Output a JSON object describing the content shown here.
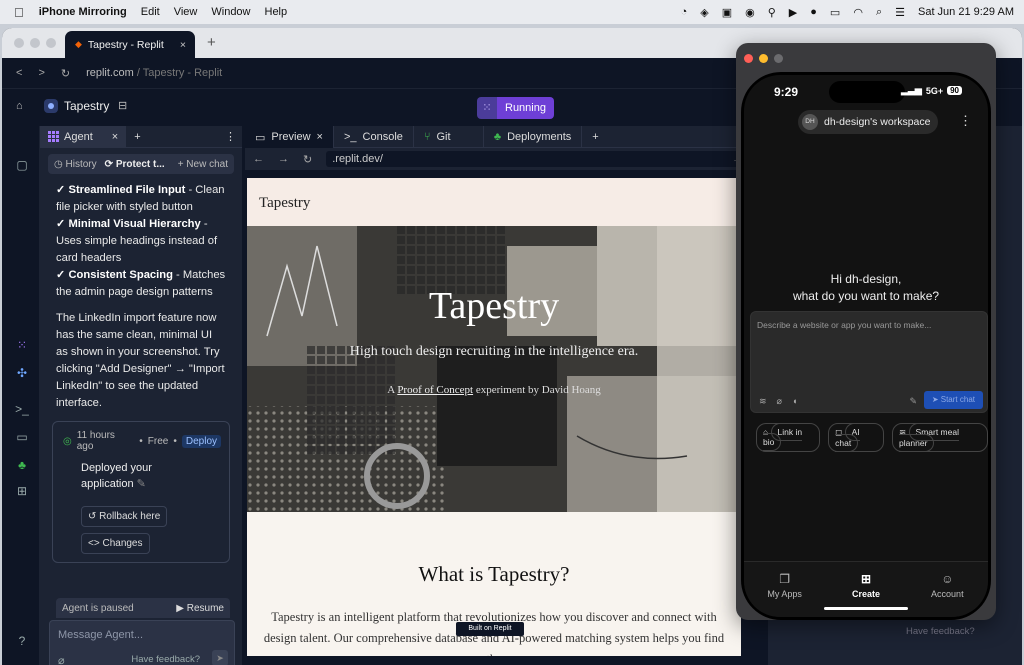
{
  "menubar": {
    "apple": "",
    "app": "iPhone Mirroring",
    "items": [
      "Edit",
      "View",
      "Window",
      "Help"
    ],
    "datetime": "Sat Jun 21  9:29 AM"
  },
  "browser": {
    "tab_title": "Tapestry - Replit",
    "url_host": "replit.com",
    "url_path": " / Tapestry - Replit"
  },
  "replit": {
    "project": "Tapestry",
    "run_status": "Running",
    "agent": {
      "tab_label": "Agent",
      "history_label": "History",
      "protect_label": "Protect t...",
      "new_chat_label": "+ New chat",
      "messages": [
        {
          "bold": "✓ Streamlined File Input",
          "text": " - Clean file picker with styled button"
        },
        {
          "bold": "✓ Minimal Visual Hierarchy",
          "text": " - Uses simple headings instead of card headers"
        },
        {
          "bold": "✓ Consistent Spacing",
          "text": " - Matches the admin page design patterns"
        }
      ],
      "summary": "The LinkedIn import feature now has the same clean, minimal UI as shown in your screenshot. Try clicking \"Add Designer\" → \"Import LinkedIn\" to see the updated interface.",
      "checkpoint": {
        "time": "11 hours ago",
        "tier": "Free",
        "badge": "Deploy",
        "title": "Deployed your application",
        "rollback": "Rollback here",
        "changes": "Changes"
      },
      "paused_text": "Agent is paused",
      "resume_label": "Resume",
      "input_placeholder": "Message Agent...",
      "feedback": "Have feedback?"
    },
    "tabs": [
      "Preview",
      "Console",
      "Git",
      "Deployments"
    ],
    "preview_url": ".replit.dev/",
    "site": {
      "brand": "Tapestry",
      "hero_title": "Tapestry",
      "hero_subtitle": "High touch design recruiting in the intelligence era.",
      "poc_prefix": "A ",
      "poc_link": "Proof of Concept",
      "poc_suffix": " experiment by David Hoang",
      "section_title": "What is Tapestry?",
      "section_text": "Tapestry is an intelligent platform that revolutionizes how you discover and connect with design talent. Our comprehensive database and AI-powered matching system helps you find the",
      "built_badge": "Built on Replit"
    },
    "right_feedback": "Have feedback?"
  },
  "phone": {
    "time": "9:29",
    "network": "5G+",
    "battery": "90",
    "workspace_initials": "DH",
    "workspace": "dh-design's workspace",
    "greeting_line1": "Hi dh-design,",
    "greeting_line2": "what do you want to make?",
    "input_placeholder": "Describe a website or app you want to make...",
    "start_chat": "Start chat",
    "chips": [
      "Link in bio",
      "AI chat",
      "Smart meal planner"
    ],
    "nav": [
      {
        "label": "My Apps",
        "icon": "apps-icon"
      },
      {
        "label": "Create",
        "icon": "plus-icon"
      },
      {
        "label": "Account",
        "icon": "person-icon"
      }
    ]
  }
}
